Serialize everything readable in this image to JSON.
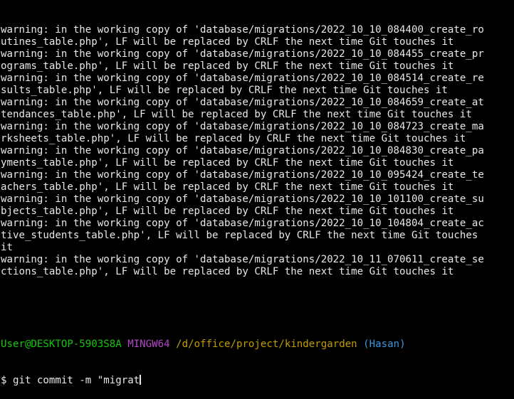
{
  "terminal": {
    "output_lines": [
      "warning: in the working copy of 'database/migrations/2022_10_10_084400_create_ro",
      "utines_table.php', LF will be replaced by CRLF the next time Git touches it",
      "warning: in the working copy of 'database/migrations/2022_10_10_084455_create_pr",
      "ograms_table.php', LF will be replaced by CRLF the next time Git touches it",
      "warning: in the working copy of 'database/migrations/2022_10_10_084514_create_re",
      "sults_table.php', LF will be replaced by CRLF the next time Git touches it",
      "warning: in the working copy of 'database/migrations/2022_10_10_084659_create_at",
      "tendances_table.php', LF will be replaced by CRLF the next time Git touches it",
      "warning: in the working copy of 'database/migrations/2022_10_10_084723_create_ma",
      "rksheets_table.php', LF will be replaced by CRLF the next time Git touches it",
      "warning: in the working copy of 'database/migrations/2022_10_10_084830_create_pa",
      "yments_table.php', LF will be replaced by CRLF the next time Git touches it",
      "warning: in the working copy of 'database/migrations/2022_10_10_095424_create_te",
      "achers_table.php', LF will be replaced by CRLF the next time Git touches it",
      "warning: in the working copy of 'database/migrations/2022_10_10_101100_create_su",
      "bjects_table.php', LF will be replaced by CRLF the next time Git touches it",
      "warning: in the working copy of 'database/migrations/2022_10_10_104804_create_ac",
      "tive_students_table.php', LF will be replaced by CRLF the next time Git touches",
      "it",
      "warning: in the working copy of 'database/migrations/2022_10_11_070611_create_se",
      "ctions_table.php', LF will be replaced by CRLF the next time Git touches it"
    ],
    "prompt": {
      "user_host": "User@DESKTOP-5903S8A",
      "shell": "MINGW64",
      "path": "/d/office/project/kindergarden",
      "branch": "(Hasan)"
    },
    "command": "$ git commit -m \"migrat",
    "colors": {
      "background": "#000000",
      "text": "#e8e8e8",
      "user_host": "#16c60c",
      "shell": "#b148c6",
      "path": "#c19c00",
      "branch": "#3a96dd"
    }
  }
}
